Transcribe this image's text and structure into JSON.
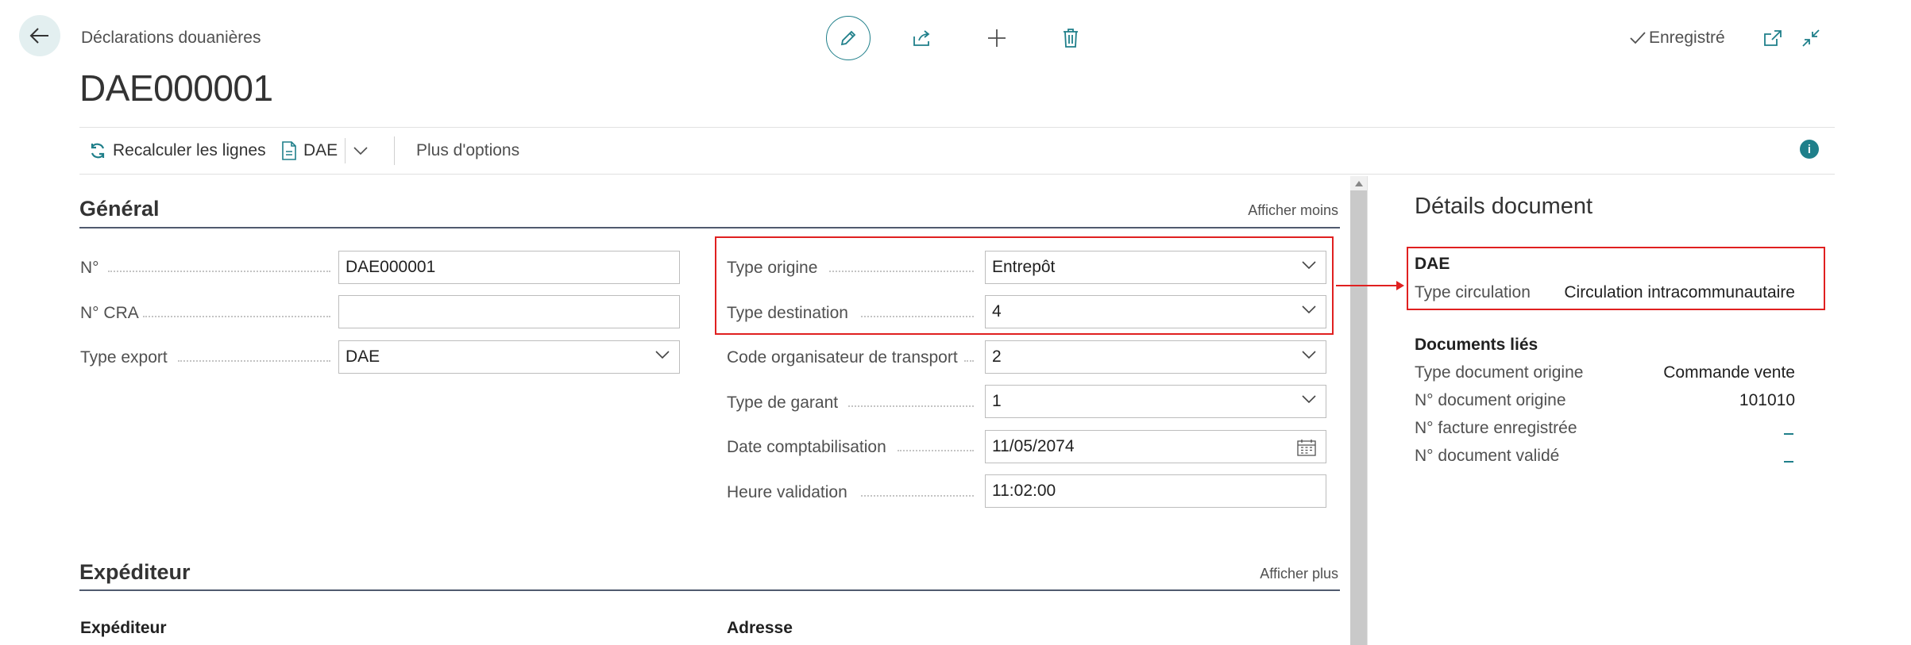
{
  "header": {
    "breadcrumb": "Déclarations douanières",
    "title": "DAE000001",
    "saved_status": "Enregistré",
    "icons": [
      "back-arrow-icon",
      "pencil-icon",
      "share-icon",
      "plus-icon",
      "trash-icon",
      "check-icon",
      "open-new-window-icon",
      "collapse-icon"
    ]
  },
  "actions": {
    "recalc": "Recalculer les lignes",
    "dae": "DAE",
    "more": "Plus d'options"
  },
  "general": {
    "title": "Général",
    "toggle": "Afficher moins",
    "left_fields": [
      {
        "label": "N°",
        "value": "DAE000001"
      },
      {
        "label": "N° CRA",
        "value": ""
      },
      {
        "label": "Type export",
        "value": "DAE"
      }
    ],
    "right_fields": [
      {
        "label": "Type origine",
        "value": "Entrepôt"
      },
      {
        "label": "Type destination",
        "value": "4"
      },
      {
        "label": "Code organisateur de transport",
        "value": "2"
      },
      {
        "label": "Type de garant",
        "value": "1"
      },
      {
        "label": "Date comptabilisation",
        "value": "11/05/2074"
      },
      {
        "label": "Heure validation",
        "value": "11:02:00"
      }
    ]
  },
  "expediteur": {
    "title": "Expéditeur",
    "toggle": "Afficher plus",
    "col1": "Expéditeur",
    "col2": "Adresse"
  },
  "factbox": {
    "title": "Détails document",
    "dae_heading": "DAE",
    "circulation_label": "Type circulation",
    "circulation_value": "Circulation intracommunautaire",
    "linked_heading": "Documents liés",
    "linked": [
      {
        "label": "Type document origine",
        "value": "Commande vente"
      },
      {
        "label": "N° document origine",
        "value": "101010"
      },
      {
        "label": "N° facture enregistrée",
        "value": ""
      },
      {
        "label": "N° document validé",
        "value": ""
      }
    ]
  },
  "colors": {
    "accent": "#1f7f8a",
    "highlight": "#e02020"
  }
}
